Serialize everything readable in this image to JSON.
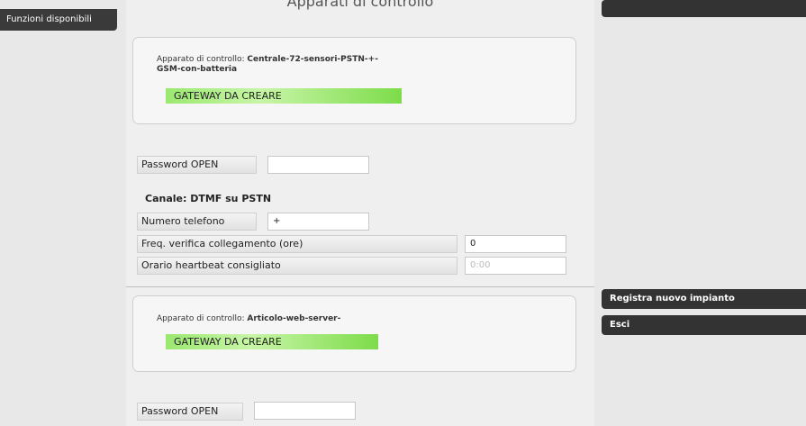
{
  "left_panel": {
    "tab_label": "Funzioni disponibili"
  },
  "main": {
    "title": "Apparati di controllo",
    "devices": [
      {
        "prefix": "Apparato di controllo: ",
        "name_line1": "Centrale-72-sensori-PSTN-+-",
        "name_line2": "GSM-con-batteria",
        "status": "GATEWAY DA CREARE",
        "password_label": "Password OPEN",
        "password_value": "",
        "channel_title": "Canale: DTMF su PSTN",
        "phone_label": "Numero telefono",
        "phone_value": "+",
        "freq_label": "Freq. verifica collegamento (ore)",
        "freq_value": "0",
        "heartbeat_label": "Orario heartbeat consigliato",
        "heartbeat_placeholder": "0:00"
      },
      {
        "prefix": "Apparato di controllo: ",
        "name": "Articolo-web-server-",
        "status": "GATEWAY DA CREARE",
        "password_label": "Password OPEN",
        "password_value": ""
      }
    ]
  },
  "right_panel": {
    "items": [
      {
        "label": "Registra nuovo impianto"
      },
      {
        "label": "Esci"
      }
    ]
  }
}
